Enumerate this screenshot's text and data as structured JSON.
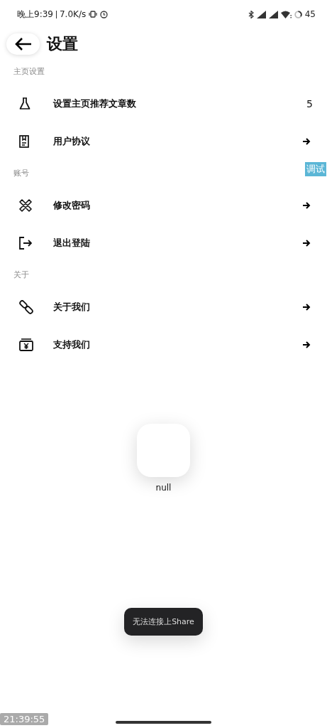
{
  "status_bar": {
    "time": "晚上9:39",
    "speed": "7.0K/s",
    "battery": "45"
  },
  "header": {
    "title": "设置"
  },
  "sections": [
    {
      "title": "主页设置",
      "items": [
        {
          "label": "设置主页推荐文章数",
          "kind": "value",
          "value": "5"
        },
        {
          "label": "用户协议",
          "kind": "arrow"
        }
      ]
    },
    {
      "title": "账号",
      "items": [
        {
          "label": "修改密码",
          "kind": "arrow"
        },
        {
          "label": "退出登陆",
          "kind": "arrow"
        }
      ]
    },
    {
      "title": "关于",
      "items": [
        {
          "label": "关于我们",
          "kind": "arrow"
        },
        {
          "label": "支持我们",
          "kind": "arrow"
        }
      ]
    }
  ],
  "debug_badge": "调试",
  "floating_app": {
    "label": "null"
  },
  "toast": "无法连接上Share",
  "timestamp": "21:39:55"
}
